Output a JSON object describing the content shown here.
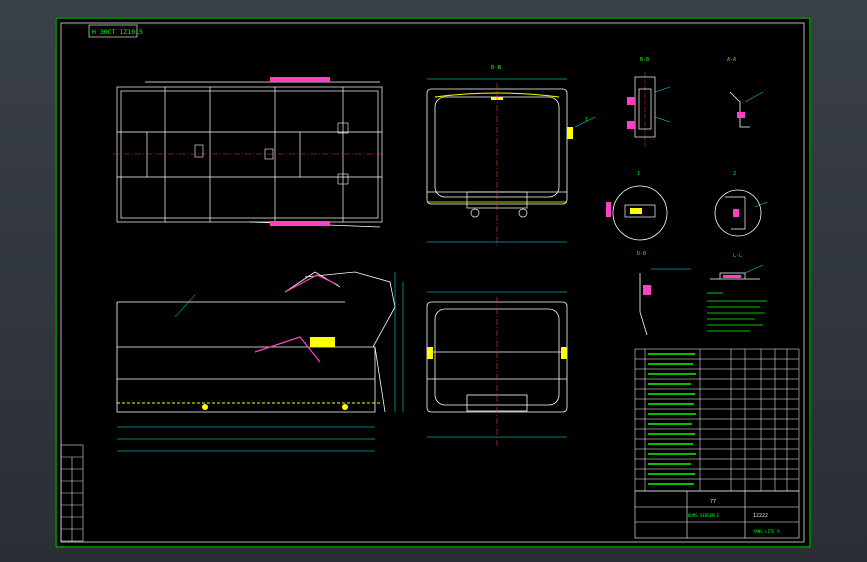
{
  "drawing": {
    "title_tag": "H 30CT 1Z1015",
    "section_top": "B-B",
    "section_bottom": "A-A",
    "detail_bb": "B-B",
    "detail_aa": "A-A",
    "detail_1": "1",
    "detail_2": "2",
    "detail_db": "D-B",
    "detail_ll": "L-L",
    "part_label": "1",
    "title_block_code": "77",
    "title_block_name": "12222",
    "drawing_name": "YANG LITE 9",
    "drawing_no": "BOMS SEREEN E"
  },
  "colors": {
    "frame_outer": "#00d000",
    "frame_inner": "#e0e0e0",
    "geometry": "#ffffff",
    "centerline": "#ff3030",
    "dimension": "#00ffff",
    "highlight": "#ff40c0",
    "yellow": "#ffff00",
    "table_green": "#00ff00"
  }
}
